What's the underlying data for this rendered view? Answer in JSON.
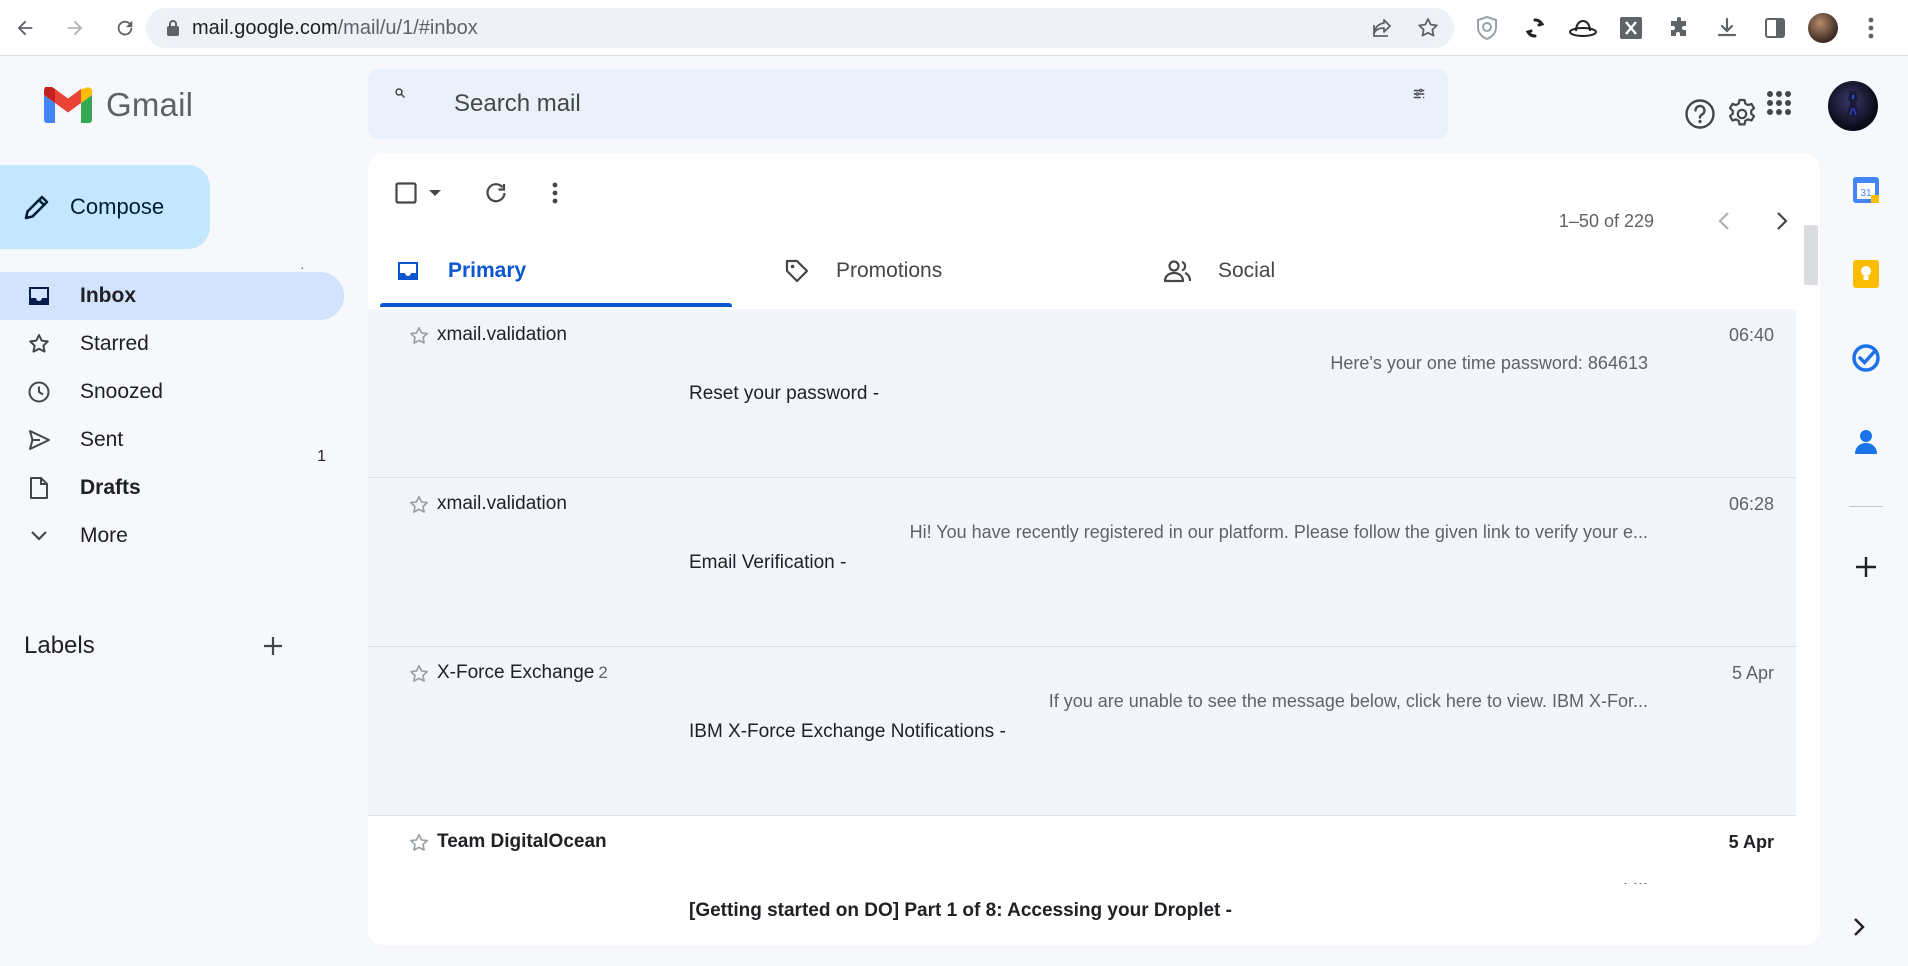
{
  "browser": {
    "url_host": "mail.google.com",
    "url_path": "/mail/u/1/#inbox"
  },
  "app": {
    "name": "Gmail"
  },
  "search": {
    "placeholder": "Search mail"
  },
  "compose": {
    "label": "Compose"
  },
  "nav": {
    "items": [
      {
        "label": "Inbox",
        "count": ""
      },
      {
        "label": "Starred",
        "count": ""
      },
      {
        "label": "Snoozed",
        "count": ""
      },
      {
        "label": "Sent",
        "count": "1"
      },
      {
        "label": "Drafts",
        "count": ""
      },
      {
        "label": "More",
        "count": ""
      }
    ]
  },
  "labels": {
    "title": "Labels"
  },
  "pager": {
    "text": "1–50 of 229"
  },
  "tabs": [
    {
      "label": "Primary"
    },
    {
      "label": "Promotions"
    },
    {
      "label": "Social"
    }
  ],
  "emails": [
    {
      "sender": "xmail.validation",
      "thread_count": "",
      "snippet": "Here's your one time password: 864613",
      "subject": "Reset your password -",
      "date": "06:40",
      "unread": false
    },
    {
      "sender": "xmail.validation",
      "thread_count": "",
      "snippet": "Hi! You have recently registered in our platform. Please follow the given link to verify your e...",
      "subject": "Email Verification -",
      "date": "06:28",
      "unread": false
    },
    {
      "sender": "X-Force Exchange",
      "thread_count": "2",
      "snippet": "If you are unable to see the message below, click here to view. IBM X-For...",
      "subject": "IBM X-Force Exchange Notifications -",
      "date": "5 Apr",
      "unread": false
    },
    {
      "sender": "Team DigitalOcean",
      "thread_count": "",
      "snippet": ". ...",
      "subject": "[Getting started on DO] Part 1 of 8: Accessing your Droplet -",
      "date": "5 Apr",
      "unread": true
    }
  ],
  "colors": {
    "accent": "#0b57d0",
    "compose_bg": "#c2e7ff",
    "active_nav": "#d3e3fd",
    "search_bg": "#eaf1fb",
    "app_bg": "#f6f8fc"
  }
}
